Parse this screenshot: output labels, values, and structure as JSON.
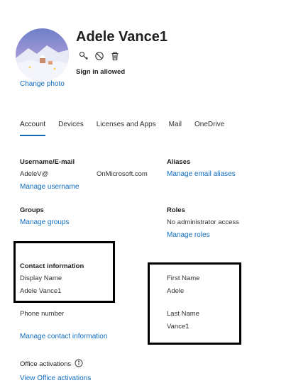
{
  "user": {
    "display_name": "Adele Vance1",
    "sign_in_status": "Sign in allowed",
    "change_photo_label": "Change photo"
  },
  "tabs": [
    {
      "label": "Account",
      "active": true
    },
    {
      "label": "Devices"
    },
    {
      "label": "Licenses and Apps"
    },
    {
      "label": "Mail"
    },
    {
      "label": "OneDrive"
    }
  ],
  "account": {
    "username": {
      "label": "Username/E-mail",
      "value_prefix": "AdeleV@",
      "value_suffix": "OnMicrosoft.com",
      "link": "Manage username"
    },
    "aliases": {
      "label": "Aliases",
      "link": "Manage email aliases"
    },
    "groups": {
      "label": "Groups",
      "link": "Manage groups"
    },
    "roles": {
      "label": "Roles",
      "value": "No administrator access",
      "link": "Manage roles"
    },
    "contact": {
      "label": "Contact information",
      "display_name_label": "Display Name",
      "display_name_value": "Adele Vance1",
      "phone_label": "Phone number",
      "link": "Manage contact information"
    },
    "names": {
      "first_label": "First Name",
      "first_value": "Adele",
      "last_label": "Last Name",
      "last_value": "Vance1"
    },
    "office": {
      "label": "Office activations",
      "link": "View Office activations"
    }
  },
  "colors": {
    "accent": "#0f6cbd",
    "highlight_box": "#000000"
  }
}
